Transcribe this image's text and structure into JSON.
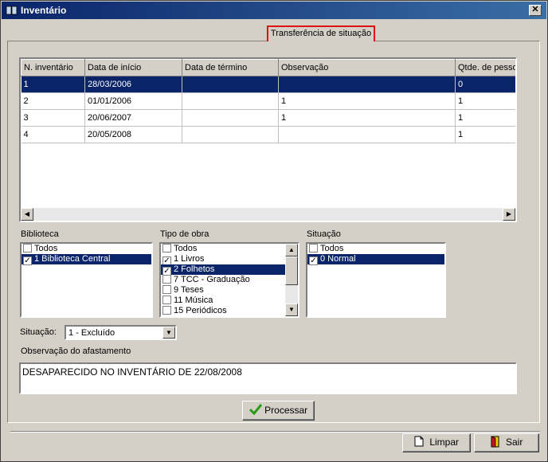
{
  "window": {
    "title": "Inventário",
    "close_glyph": "✕"
  },
  "tab": {
    "label": "Transferência de situação"
  },
  "grid": {
    "columns": [
      "N. inventário",
      "Data de início",
      "Data de término",
      "Observação",
      "Qtde. de pessoa"
    ],
    "rows": [
      [
        "1",
        "28/03/2006",
        "",
        "",
        "0"
      ],
      [
        "2",
        "01/01/2006",
        "",
        "1",
        "1"
      ],
      [
        "3",
        "20/06/2007",
        "",
        "1",
        "1"
      ],
      [
        "4",
        "20/05/2008",
        "",
        "",
        "1"
      ]
    ],
    "selected_row": 0
  },
  "biblioteca": {
    "label": "Biblioteca",
    "items": [
      {
        "label": "Todos",
        "checked": false,
        "selected": false
      },
      {
        "label": "1 Biblioteca Central",
        "checked": true,
        "selected": true
      }
    ]
  },
  "tipo_obra": {
    "label": "Tipo de obra",
    "items": [
      {
        "label": "Todos",
        "checked": false,
        "selected": false
      },
      {
        "label": "1 Livros",
        "checked": true,
        "selected": false
      },
      {
        "label": "2 Folhetos",
        "checked": true,
        "selected": true
      },
      {
        "label": "7 TCC - Graduação",
        "checked": false,
        "selected": false
      },
      {
        "label": "9 Teses",
        "checked": false,
        "selected": false
      },
      {
        "label": "11 Música",
        "checked": false,
        "selected": false
      },
      {
        "label": "15 Periódicos",
        "checked": false,
        "selected": false
      }
    ]
  },
  "situacao_list": {
    "label": "Situação",
    "items": [
      {
        "label": "Todos",
        "checked": false,
        "selected": false
      },
      {
        "label": "0 Normal",
        "checked": true,
        "selected": true
      }
    ]
  },
  "situacao_field": {
    "label": "Situação:",
    "value": "1 - Excluído"
  },
  "observacao": {
    "label": "Observação do afastamento",
    "value": "DESAPARECIDO NO INVENTÁRIO DE 22/08/2008"
  },
  "buttons": {
    "processar": "Processar",
    "limpar": "Limpar",
    "sair": "Sair"
  },
  "colors": {
    "title_start": "#0a246a",
    "title_end": "#3a6ea5",
    "selection": "#0a246a",
    "tab_border": "#e01010"
  }
}
